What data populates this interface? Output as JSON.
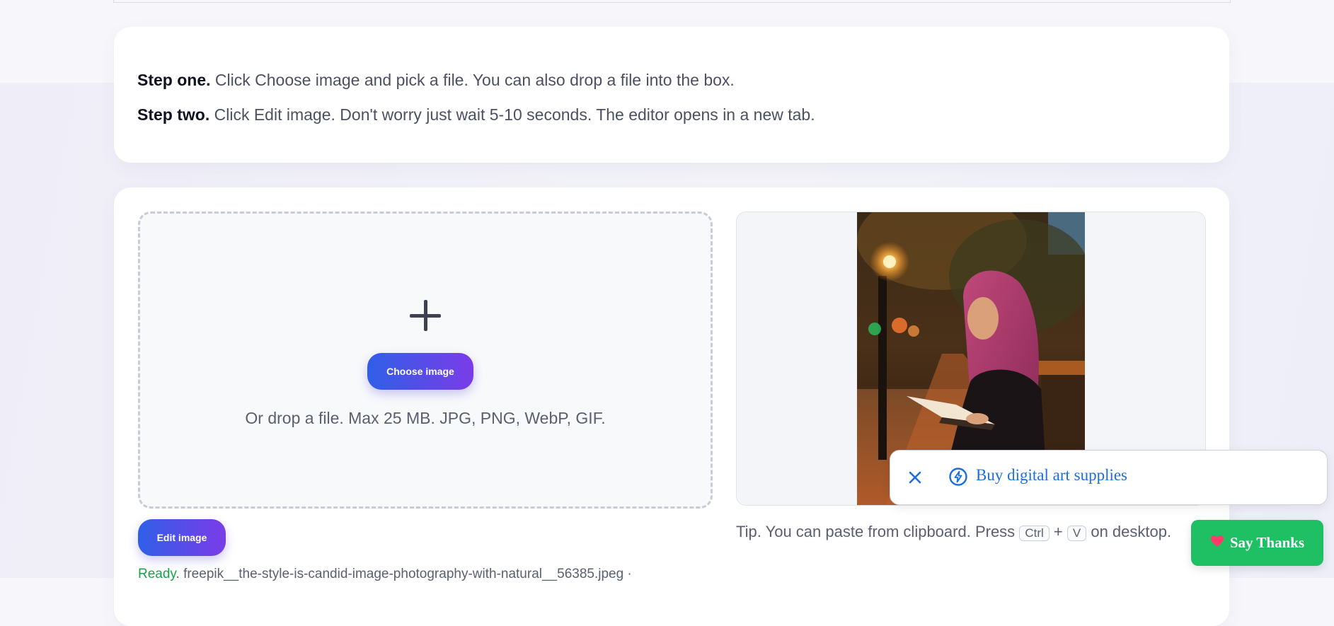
{
  "instructions": {
    "step_one_label": "Step one.",
    "step_one_text": "Click Choose image and pick a file. You can also drop a file into the box.",
    "step_two_label": "Step two.",
    "step_two_text": "Click Edit image. Don't worry just wait 5-10 seconds. The editor opens in a new tab."
  },
  "upload": {
    "choose_button": "Choose image",
    "drop_hint": "Or drop a file. Max 25 MB. JPG, PNG, WebP, GIF.",
    "edit_button": "Edit image",
    "status_ready": "Ready",
    "status_file": ". freepik__the-style-is-candid-image-photography-with-natural__56385.jpeg ·"
  },
  "tip": {
    "prefix": "Tip. You can paste from clipboard. Press",
    "key_ctrl": "Ctrl",
    "plus": "+",
    "key_v": "V",
    "suffix": "on desktop."
  },
  "promo": {
    "text": "Buy digital art supplies",
    "close_icon": "close-icon",
    "bolt_icon": "lightning-icon"
  },
  "thanks": {
    "label": "Say Thanks",
    "icon": "heart-icon"
  },
  "colors": {
    "accent_start": "#2f5fe8",
    "accent_end": "#7b3ce8",
    "ready_green": "#17a34a",
    "thanks_green": "#1fbf64",
    "promo_blue": "#1a6fd8"
  }
}
